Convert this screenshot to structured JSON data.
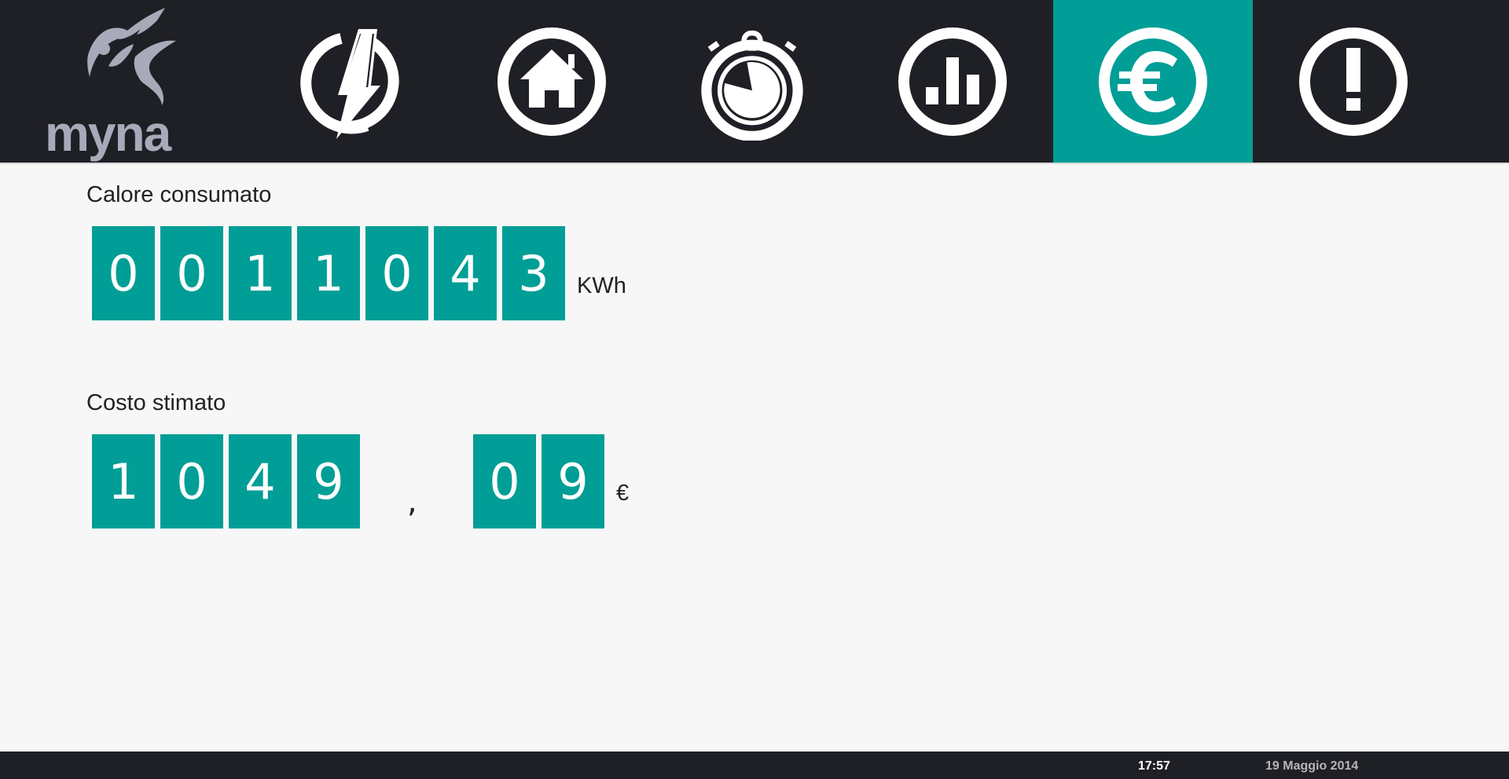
{
  "brand": {
    "name": "myna"
  },
  "nav": {
    "items": [
      {
        "name": "energy",
        "icon": "lightning-icon"
      },
      {
        "name": "home",
        "icon": "home-icon"
      },
      {
        "name": "timer",
        "icon": "stopwatch-icon"
      },
      {
        "name": "statistics",
        "icon": "bar-chart-icon"
      },
      {
        "name": "cost",
        "icon": "euro-icon",
        "active": true
      },
      {
        "name": "alerts",
        "icon": "exclamation-icon"
      }
    ]
  },
  "heat": {
    "label": "Calore consumato",
    "digits": [
      "0",
      "0",
      "1",
      "1",
      "0",
      "4",
      "3"
    ],
    "unit": "KWh"
  },
  "cost": {
    "label": "Costo stimato",
    "integer_digits": [
      "1",
      "0",
      "4",
      "9"
    ],
    "separator": ",",
    "decimal_digits": [
      "0",
      "9"
    ],
    "unit": "€"
  },
  "status": {
    "time": "17:57",
    "date": "19 Maggio 2014"
  },
  "colors": {
    "accent": "#009e96",
    "bar": "#1f2025",
    "background": "#f7f7f7"
  }
}
